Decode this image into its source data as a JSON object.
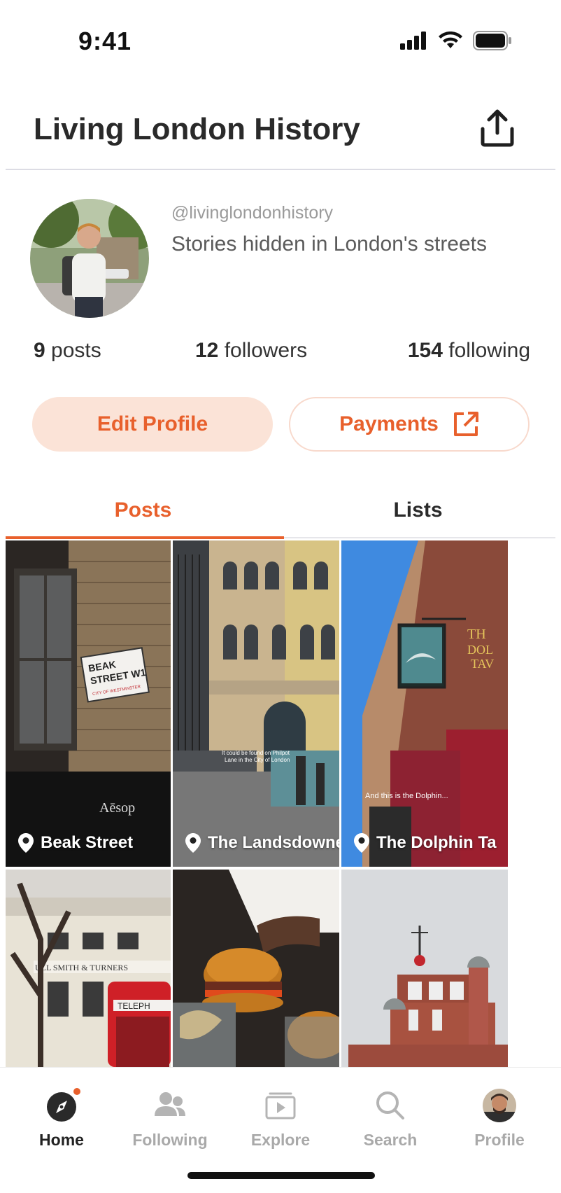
{
  "status_bar": {
    "time": "9:41"
  },
  "header": {
    "title": "Living London History"
  },
  "profile": {
    "handle": "@livinglondonhistory",
    "bio": "Stories hidden in London's streets"
  },
  "stats": {
    "posts_count": "9",
    "posts_label": "posts",
    "followers_count": "12",
    "followers_label": "followers",
    "following_count": "154",
    "following_label": "following"
  },
  "buttons": {
    "edit_profile": "Edit Profile",
    "payments": "Payments"
  },
  "tabs": {
    "posts": "Posts",
    "lists": "Lists",
    "active": "Posts"
  },
  "posts": [
    {
      "caption": "Beak Street",
      "sign_text": [
        "BEAK",
        "STREET W1",
        "CITY OF WESTMINSTER"
      ],
      "shop_text": "Aēsop"
    },
    {
      "caption": "The Landsdowne",
      "overlay_text": [
        "It could be found on Philpot",
        "Lane in the City of London"
      ]
    },
    {
      "caption": "The Dolphin Ta",
      "overlay_text": "And this is the Dolphin..."
    },
    {
      "caption": "",
      "shop_text": "ULL SMITH & TURNERS"
    },
    {
      "caption": ""
    },
    {
      "caption": ""
    }
  ],
  "tabbar": {
    "items": [
      {
        "label": "Home",
        "icon": "compass-icon",
        "active": true
      },
      {
        "label": "Following",
        "icon": "people-icon"
      },
      {
        "label": "Explore",
        "icon": "play-icon"
      },
      {
        "label": "Search",
        "icon": "search-icon"
      },
      {
        "label": "Profile",
        "icon": "avatar"
      }
    ]
  },
  "colors": {
    "accent": "#e8602c",
    "accent_light": "#fbe3d7",
    "text_muted": "#a9a9a9"
  }
}
